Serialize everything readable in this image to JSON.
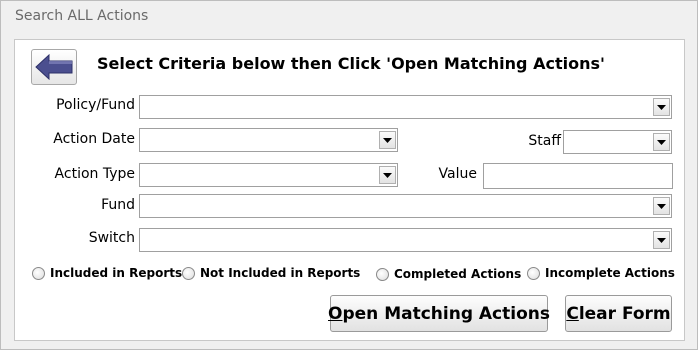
{
  "window": {
    "title": "Search ALL Actions"
  },
  "heading": "Select Criteria below then Click 'Open Matching Actions'",
  "fields": {
    "policy_fund": {
      "label": "Policy/Fund",
      "value": ""
    },
    "action_date": {
      "label": "Action Date",
      "value": ""
    },
    "staff": {
      "label": "Staff",
      "value": ""
    },
    "action_type": {
      "label": "Action Type",
      "value": ""
    },
    "value": {
      "label": "Value",
      "value": ""
    },
    "fund": {
      "label": "Fund",
      "value": ""
    },
    "switch": {
      "label": "Switch",
      "value": ""
    }
  },
  "radios": [
    {
      "label": "Included in Reports",
      "checked": false
    },
    {
      "label": "Not Included in Reports",
      "checked": false
    },
    {
      "label": "Completed Actions",
      "checked": false
    },
    {
      "label": "Incomplete Actions",
      "checked": false
    }
  ],
  "buttons": {
    "open": {
      "accel": "O",
      "rest": "pen Matching Actions"
    },
    "clear": {
      "accel": "C",
      "rest": "lear Form"
    }
  },
  "colors": {
    "arrow": "#4b4f8f",
    "panel_bg": "#ffffff",
    "window_bg": "#f0f0f0"
  }
}
